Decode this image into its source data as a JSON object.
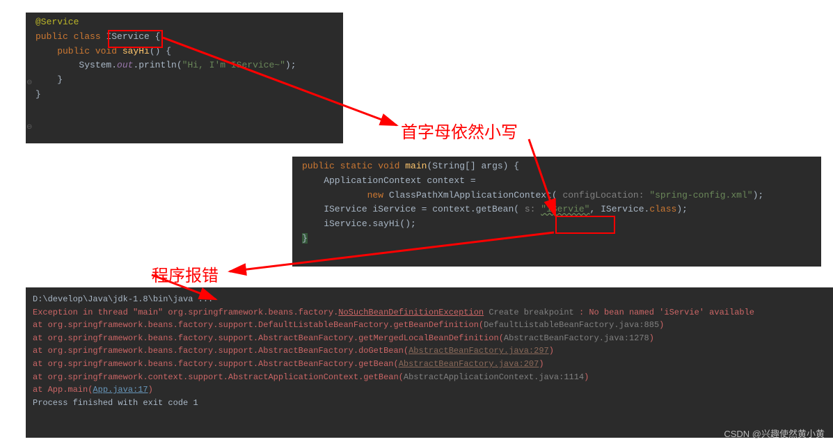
{
  "top": {
    "l1_ann": "@Service",
    "l2_kw1": "public class",
    "l2_cls": "IService",
    "l2_brace": " {",
    "l3": "",
    "l4_kw": "    public void ",
    "l4_m": "sayHi",
    "l4_rest": "() {",
    "l5_a": "        System.",
    "l5_b": "out",
    "l5_c": ".println(",
    "l5_d": "\"Hi, I'm IService~\"",
    "l5_e": ");",
    "l6": "    }",
    "l7": "}"
  },
  "mid": {
    "l1_kw": "public static void ",
    "l1_m": "main",
    "l1_r1": "(String[] args) ",
    "l1_b": "{",
    "l2": "    ApplicationContext context =",
    "l3_a": "            ",
    "l3_kw": "new ",
    "l3_cls": "ClassPathXmlApplicationContext",
    "l3_p1": "( ",
    "l3_hint": "configLocation: ",
    "l3_str": "\"spring-config.xml\"",
    "l3_p2": ");",
    "l4_a": "    IService iService = context.getBean( ",
    "l4_hint": "s: ",
    "l4_str": "\"iServie\"",
    "l4_b": ", IService.",
    "l4_kw": "class",
    "l4_c": ");",
    "l5": "    iService.sayHi();",
    "l6": "}"
  },
  "bot": {
    "l1": "D:\\develop\\Java\\jdk-1.8\\bin\\java ...",
    "l2a": "Exception in thread \"main\" org.springframework.beans.factory.",
    "l2link": "NoSuchBeanDefinitionException",
    "l2b": " Create breakpoint ",
    "l2c": ": No bean named 'iServie' available",
    "l3a": "    at org.springframework.beans.factory.support.DefaultListableBeanFactory.getBeanDefinition(",
    "l3b": "DefaultListableBeanFactory.java:885",
    "l3c": ")",
    "l4a": "    at org.springframework.beans.factory.support.AbstractBeanFactory.getMergedLocalBeanDefinition(",
    "l4b": "AbstractBeanFactory.java:1278",
    "l4c": ")",
    "l5a": "    at org.springframework.beans.factory.support.AbstractBeanFactory.doGetBean(",
    "l5b": "AbstractBeanFactory.java:297",
    "l5c": ")",
    "l6a": "    at org.springframework.beans.factory.support.AbstractBeanFactory.getBean(",
    "l6b": "AbstractBeanFactory.java:207",
    "l6c": ")",
    "l7a": "    at org.springframework.context.support.AbstractApplicationContext.getBean(",
    "l7b": "AbstractApplicationContext.java:1114",
    "l7c": ")",
    "l8a": "    at App.main(",
    "l8b": "App.java:17",
    "l8c": ")",
    "l9": "",
    "l10": "Process finished with exit code 1"
  },
  "annotations": {
    "a1": "首字母依然小写",
    "a2": "程序报错"
  },
  "watermark": "CSDN @兴趣使然黄小黄"
}
